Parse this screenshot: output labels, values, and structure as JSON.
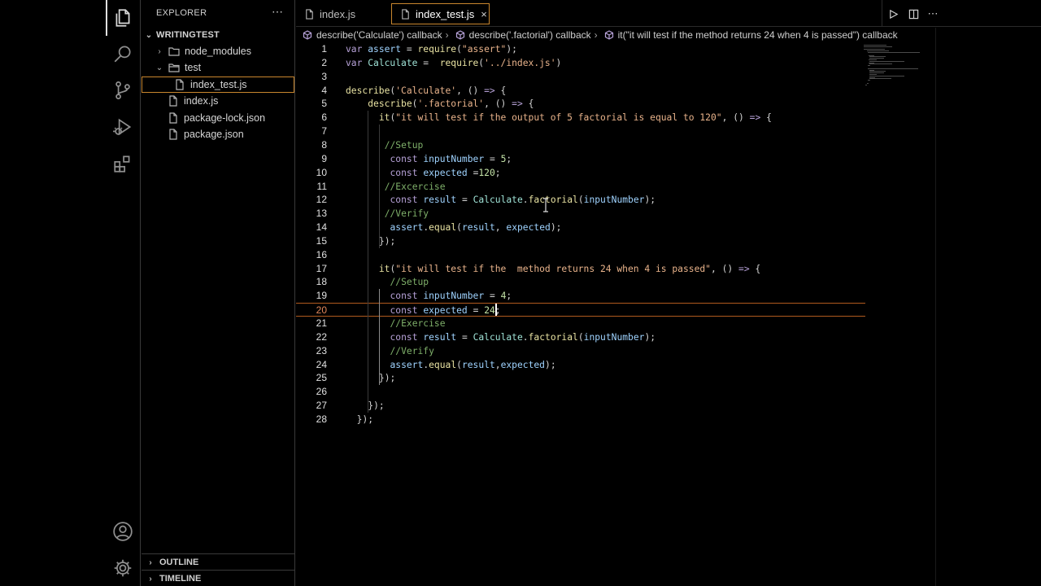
{
  "activity_bar": {
    "items": [
      "files-icon",
      "search-icon",
      "source-control-icon",
      "run-debug-icon",
      "extensions-icon"
    ],
    "bottom": [
      "account-icon",
      "settings-gear-icon"
    ]
  },
  "sidebar": {
    "header": "EXPLORER",
    "more": "⋯",
    "root": "WRITINGTEST",
    "tree": [
      {
        "label": "node_modules",
        "type": "folder",
        "expanded": false
      },
      {
        "label": "test",
        "type": "folder",
        "expanded": true
      },
      {
        "label": "index_test.js",
        "type": "file",
        "selected": true
      },
      {
        "label": "index.js",
        "type": "file"
      },
      {
        "label": "package-lock.json",
        "type": "file"
      },
      {
        "label": "package.json",
        "type": "file"
      }
    ],
    "outline": "OUTLINE",
    "timeline": "TIMELINE"
  },
  "tabs": [
    {
      "label": "index.js",
      "active": false
    },
    {
      "label": "index_test.js",
      "active": true,
      "close": "×"
    }
  ],
  "breadcrumb": [
    "describe('Calculate') callback",
    "describe('.factorial') callback",
    "it(\"it will test if the  method returns 24 when 4 is passed\") callback"
  ],
  "editor": {
    "current_line": 20,
    "line_numbers": [
      "1",
      "2",
      "3",
      "4",
      "5",
      "6",
      "7",
      "8",
      "9",
      "10",
      "11",
      "12",
      "13",
      "14",
      "15",
      "16",
      "17",
      "18",
      "19",
      "20",
      "21",
      "22",
      "23",
      "24",
      "25",
      "26",
      "27",
      "28"
    ],
    "lines": [
      "var assert = require(\"assert\");",
      "var Calculate =  require('../index.js')",
      "",
      "describe('Calculate', () => {",
      "    describe('.factorial', () => {",
      "      it(\"it will test if the output of 5 factorial is equal to 120\", () => {",
      "",
      "       //Setup",
      "        const inputNumber = 5;",
      "        const expected =120;",
      "       //Excercise",
      "        const result = Calculate.factorial(inputNumber);",
      "       //Verify",
      "        assert.equal(result, expected);",
      "      });",
      "",
      "      it(\"it will test if the  method returns 24 when 4 is passed\", () => {",
      "        //Setup",
      "        const inputNumber = 4;",
      "        const expected = 24;",
      "        //Exercise",
      "        const result = Calculate.factorial(inputNumber);",
      "        //Verify",
      "        assert.equal(result,expected);",
      "      });",
      "",
      "    });",
      "  });"
    ]
  },
  "colors": {
    "accent_orange": "#c8862e",
    "keyword": "#b7a2d8",
    "identifier": "#9fd3ff",
    "string": "#e9b38b",
    "comment": "#7fb06a",
    "number": "#c5e5a8"
  }
}
